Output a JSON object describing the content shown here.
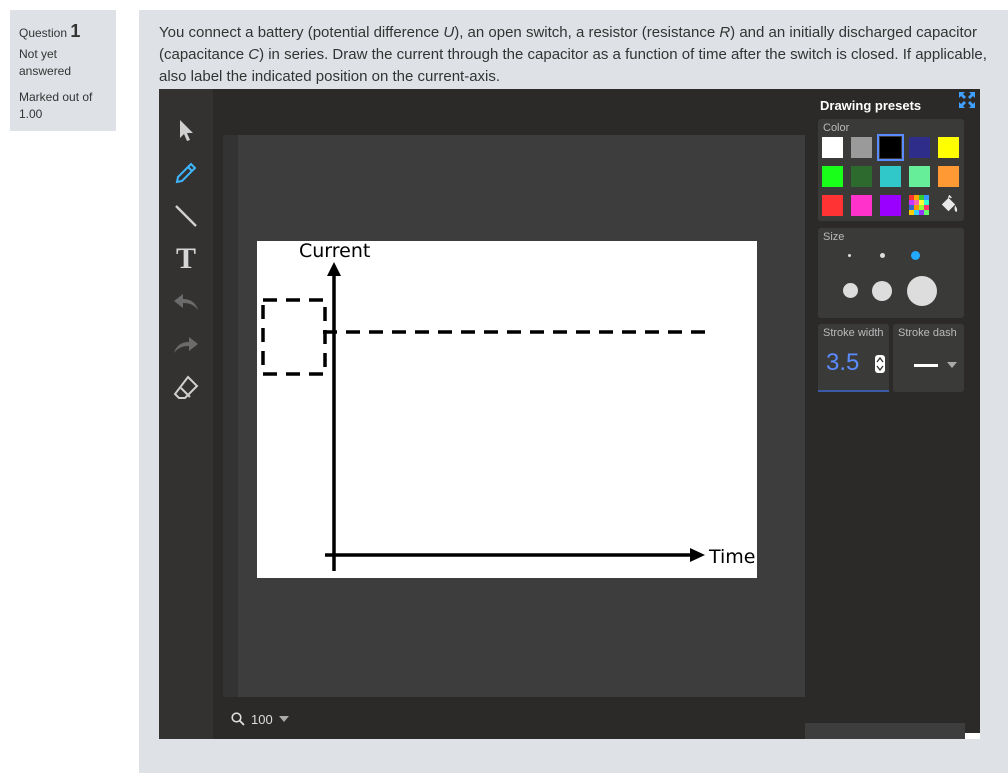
{
  "question": {
    "prefix": "Question",
    "number": "1",
    "status": "Not yet answered",
    "marked": "Marked out of 1.00"
  },
  "prompt": {
    "t1": "You connect a battery (potential difference ",
    "v1": "U",
    "t2": "), an open switch, a resistor (resistance ",
    "v2": "R",
    "t3": ") and an initially discharged capacitor (capacitance ",
    "v3": "C",
    "t4": ") in series. Draw the current through the capacitor as a function of time after the switch is closed. If applicable, also label the indicated position on the current-axis."
  },
  "toolbar": {
    "icons": [
      "select-pointer-icon",
      "pencil-icon",
      "line-icon",
      "text-icon",
      "undo-icon",
      "redo-icon",
      "eraser-icon"
    ],
    "text_tool_glyph": "T"
  },
  "canvas": {
    "y_axis_label": "Current",
    "x_axis_label": "Time"
  },
  "zoom": {
    "value": "100"
  },
  "presets": {
    "title": "Drawing presets",
    "color_label": "Color",
    "colors": [
      "#ffffff",
      "#9a9a9a",
      "#000000",
      "#2e2e8a",
      "#ffff00",
      "#19ff19",
      "#2d6a2d",
      "#30c8c8",
      "#66ee99",
      "#ff9933",
      "#ff3333",
      "#ff33cc",
      "#9900ff"
    ],
    "selected_color": "#000000",
    "size_label": "Size",
    "selected_size_color": "#22aaff",
    "stroke_width_label": "Stroke width",
    "stroke_width_value": "3.5",
    "stroke_dash_label": "Stroke dash"
  }
}
